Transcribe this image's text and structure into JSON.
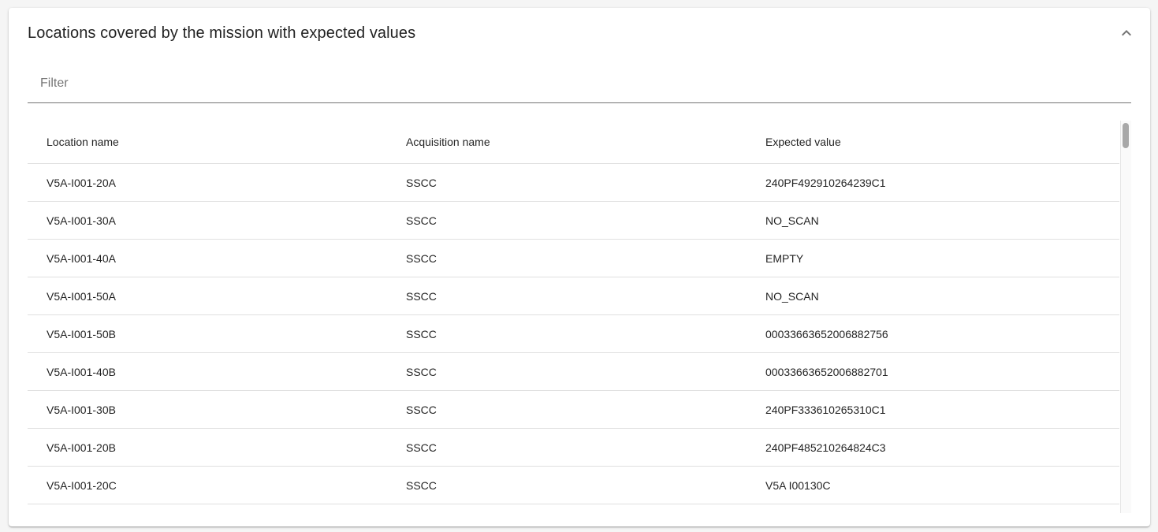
{
  "panel": {
    "title": "Locations covered by the mission with expected values",
    "expanded": true
  },
  "filter": {
    "placeholder": "Filter",
    "value": ""
  },
  "table": {
    "columns": [
      "Location name",
      "Acquisition name",
      "Expected value"
    ],
    "rows": [
      [
        "V5A-I001-20A",
        "SSCC",
        "240PF492910264239C1"
      ],
      [
        "V5A-I001-30A",
        "SSCC",
        "NO_SCAN"
      ],
      [
        "V5A-I001-40A",
        "SSCC",
        "EMPTY"
      ],
      [
        "V5A-I001-50A",
        "SSCC",
        "NO_SCAN"
      ],
      [
        "V5A-I001-50B",
        "SSCC",
        "00033663652006882756"
      ],
      [
        "V5A-I001-40B",
        "SSCC",
        "00033663652006882701"
      ],
      [
        "V5A-I001-30B",
        "SSCC",
        "240PF333610265310C1"
      ],
      [
        "V5A-I001-20B",
        "SSCC",
        "240PF485210264824C3"
      ],
      [
        "V5A-I001-20C",
        "SSCC",
        "V5A I00130C"
      ]
    ]
  },
  "icons": {
    "collapse": "chevron-up-icon"
  }
}
